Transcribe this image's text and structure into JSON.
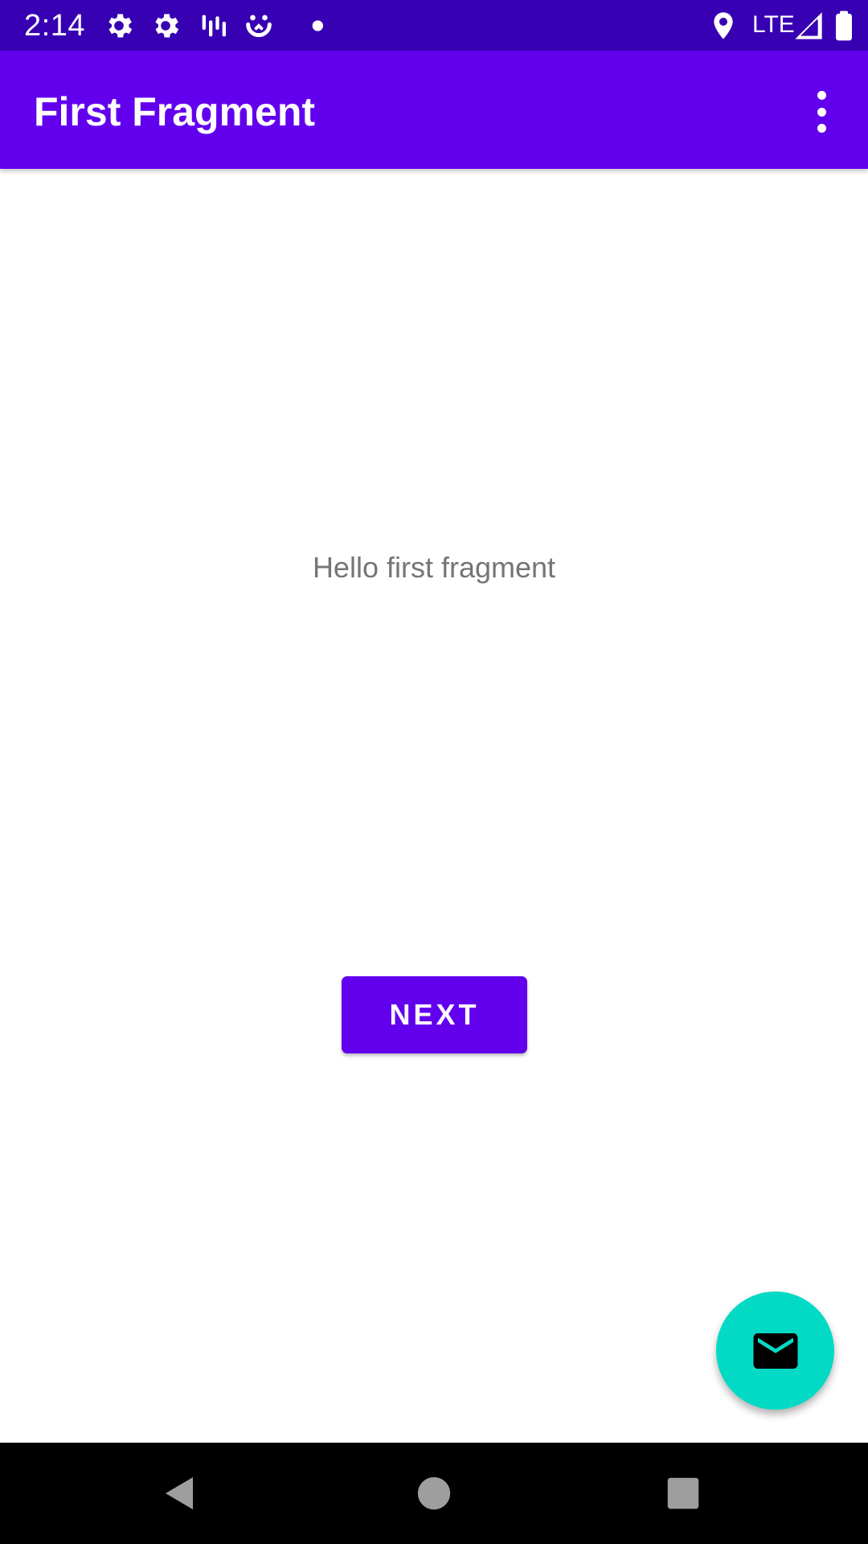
{
  "status_bar": {
    "time": "2:14",
    "network": "LTE",
    "background_color": "#3700B3",
    "icons": [
      "settings-icon",
      "settings-icon",
      "sound-bars-icon",
      "smiley-icon",
      "notification-dot-icon",
      "location-icon",
      "signal-icon",
      "battery-icon"
    ]
  },
  "app_bar": {
    "title": "First Fragment",
    "background_color": "#6200EE",
    "menu_icon": "overflow-menu-icon"
  },
  "main": {
    "message": "Hello first fragment",
    "next_button_label": "NEXT"
  },
  "fab": {
    "icon": "mail-icon",
    "background_color": "#03DAC5"
  },
  "nav_bar": {
    "buttons": [
      "back-icon",
      "home-icon",
      "recents-icon"
    ]
  }
}
